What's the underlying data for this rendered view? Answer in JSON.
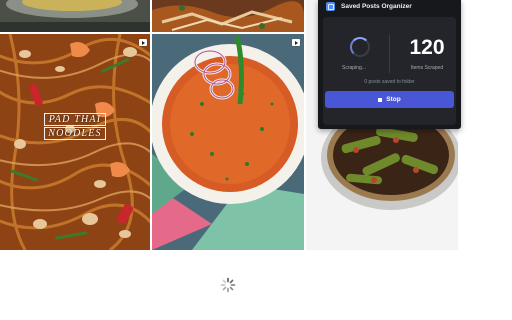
{
  "feed": {
    "posts": [
      {
        "image": "food-photo-top-left"
      },
      {
        "image": "food-photo-top-middle"
      },
      {
        "image": "pad-thai-noodles-photo",
        "caption_lines": [
          "PAD THAI",
          "NOODLES"
        ]
      },
      {
        "image": "curry-bowl-with-onion-rings-photo"
      },
      {
        "image": "stuffed-chili-peppers-plate-photo"
      }
    ],
    "reel_icon": "reel-play-icon",
    "loading_icon": "loading-spinner-icon"
  },
  "organizer": {
    "title": "Saved Posts Organizer",
    "icon": "organizer-app-icon",
    "status_label": "Scraping...",
    "items_count": "120",
    "items_label": "Items Scraped",
    "saved_count": "0",
    "saved_suffix": "posts saved to folder",
    "stop_label": "Stop",
    "accent_color": "#4956d6",
    "background_color": "#17181c"
  }
}
